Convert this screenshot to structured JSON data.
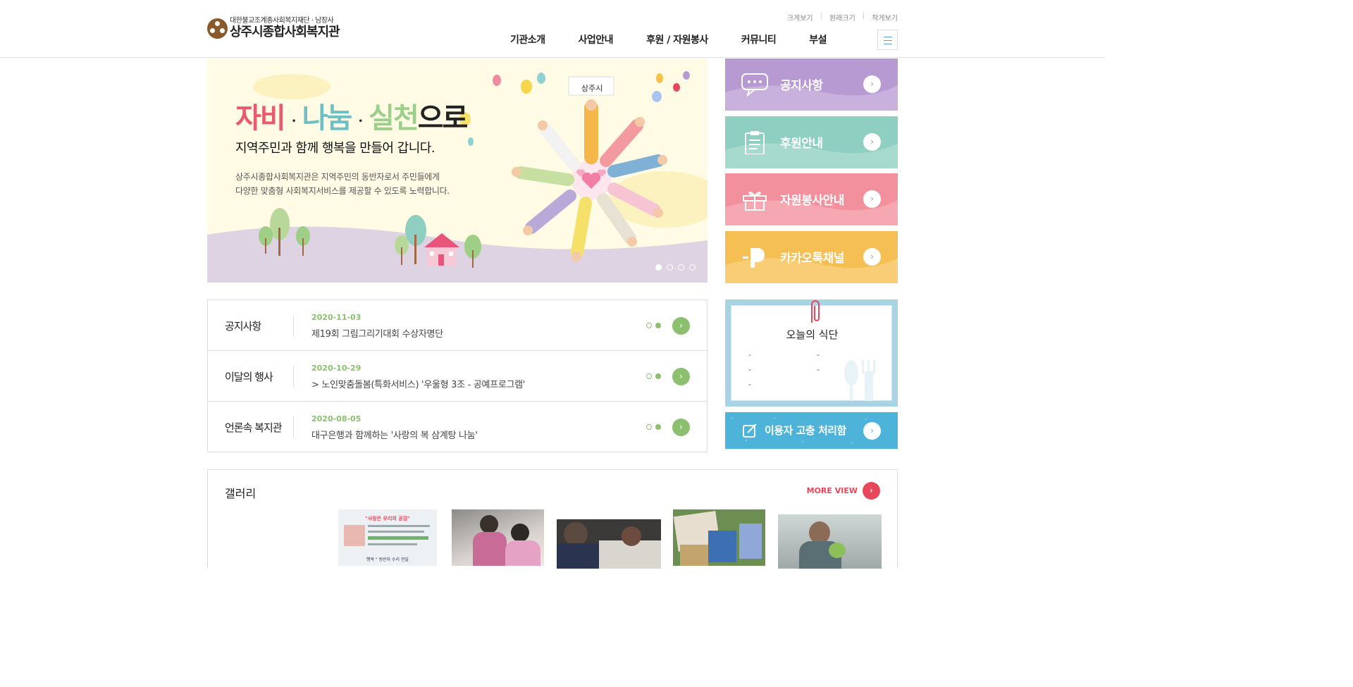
{
  "header": {
    "logo_sub": "대한불교조계종사회복지재단 · 남장사",
    "logo_main": "상주시종합사회복지관",
    "util": [
      "크게보기",
      "원래크기",
      "작게보기"
    ],
    "gnb": [
      "기관소개",
      "사업안내",
      "후원 / 자원봉사",
      "커뮤니티",
      "부설"
    ]
  },
  "banner": {
    "title_parts": [
      "자비",
      "나눔",
      "실천",
      "으로"
    ],
    "title_sep": "·",
    "headline": "지역주민과 함께 행복을 만들어 갑니다.",
    "desc_line1": "상주시종합사회복지관은 지역주민의 동반자로서 주민들에게",
    "desc_line2": "다양한 맞춤형 사회복지서비스를 제공할 수 있도록 노력합니다.",
    "sign_text": "상주시",
    "slide_count": 4,
    "active_slide": 1
  },
  "quick_links": [
    {
      "label": "공지사항",
      "icon": "speech-bubble-icon",
      "color": "#b79ad1"
    },
    {
      "label": "후원안내",
      "icon": "clipboard-icon",
      "color": "#8fcfc1"
    },
    {
      "label": "자원봉사안내",
      "icon": "gift-icon",
      "color": "#f3909e"
    },
    {
      "label": "카카오톡채널",
      "icon": "kakao-plus-icon",
      "color": "#f6bf53"
    }
  ],
  "news": [
    {
      "category": "공지사항",
      "date": "2020-11-03",
      "title": "제19회 그림그리기대회 수상자명단"
    },
    {
      "category": "이달의 행사",
      "date": "2020-10-29",
      "title": "> 노인맞춤돌봄(특화서비스) '우울형 3조 - 공예프로그램'"
    },
    {
      "category": "언론속 복지관",
      "date": "2020-08-05",
      "title": "대구은행과 함께하는 '사랑의 복 삼계탕 나눔'"
    }
  ],
  "menu_box": {
    "title": "오늘의 식단",
    "items": [
      "-",
      "-",
      "-",
      "-",
      "-"
    ]
  },
  "complaint": {
    "label": "이용자 고충 처리함"
  },
  "gallery": {
    "title": "갤러리",
    "more_label": "MORE VIEW",
    "poster_headline": "\"사랑은 우리의 공감\"",
    "poster_footer": "행복 \" 동반자 수리 전달"
  }
}
